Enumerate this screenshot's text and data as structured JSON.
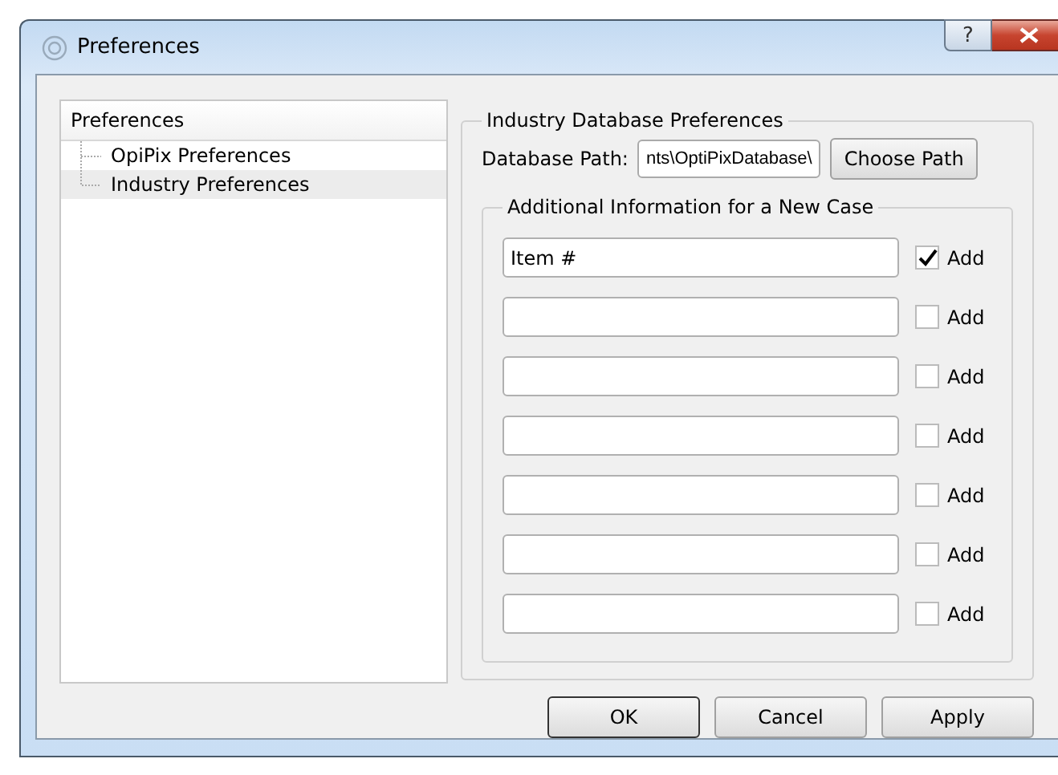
{
  "window": {
    "title": "Preferences",
    "help_button": "?"
  },
  "tree": {
    "header": "Preferences",
    "items": [
      {
        "label": "OpiPix Preferences",
        "selected": false
      },
      {
        "label": "Industry Preferences",
        "selected": true
      }
    ]
  },
  "group": {
    "title": "Industry Database Preferences",
    "path_label": "Database Path:",
    "path_value": "nts\\OptiPixDatabase\\",
    "choose_button": "Choose Path",
    "inner_title": "Additional Information for a New Case",
    "rows": [
      {
        "value": "Item #",
        "checked": true,
        "label": "Add"
      },
      {
        "checked": false,
        "label": "Add"
      },
      {
        "checked": false,
        "label": "Add"
      },
      {
        "checked": false,
        "label": "Add"
      },
      {
        "checked": false,
        "label": "Add"
      },
      {
        "checked": false,
        "label": "Add"
      },
      {
        "checked": false,
        "label": "Add"
      }
    ]
  },
  "buttons": [
    {
      "label": "OK",
      "default": true
    },
    {
      "label": "Cancel",
      "default": false
    },
    {
      "label": "Apply",
      "default": false
    }
  ]
}
